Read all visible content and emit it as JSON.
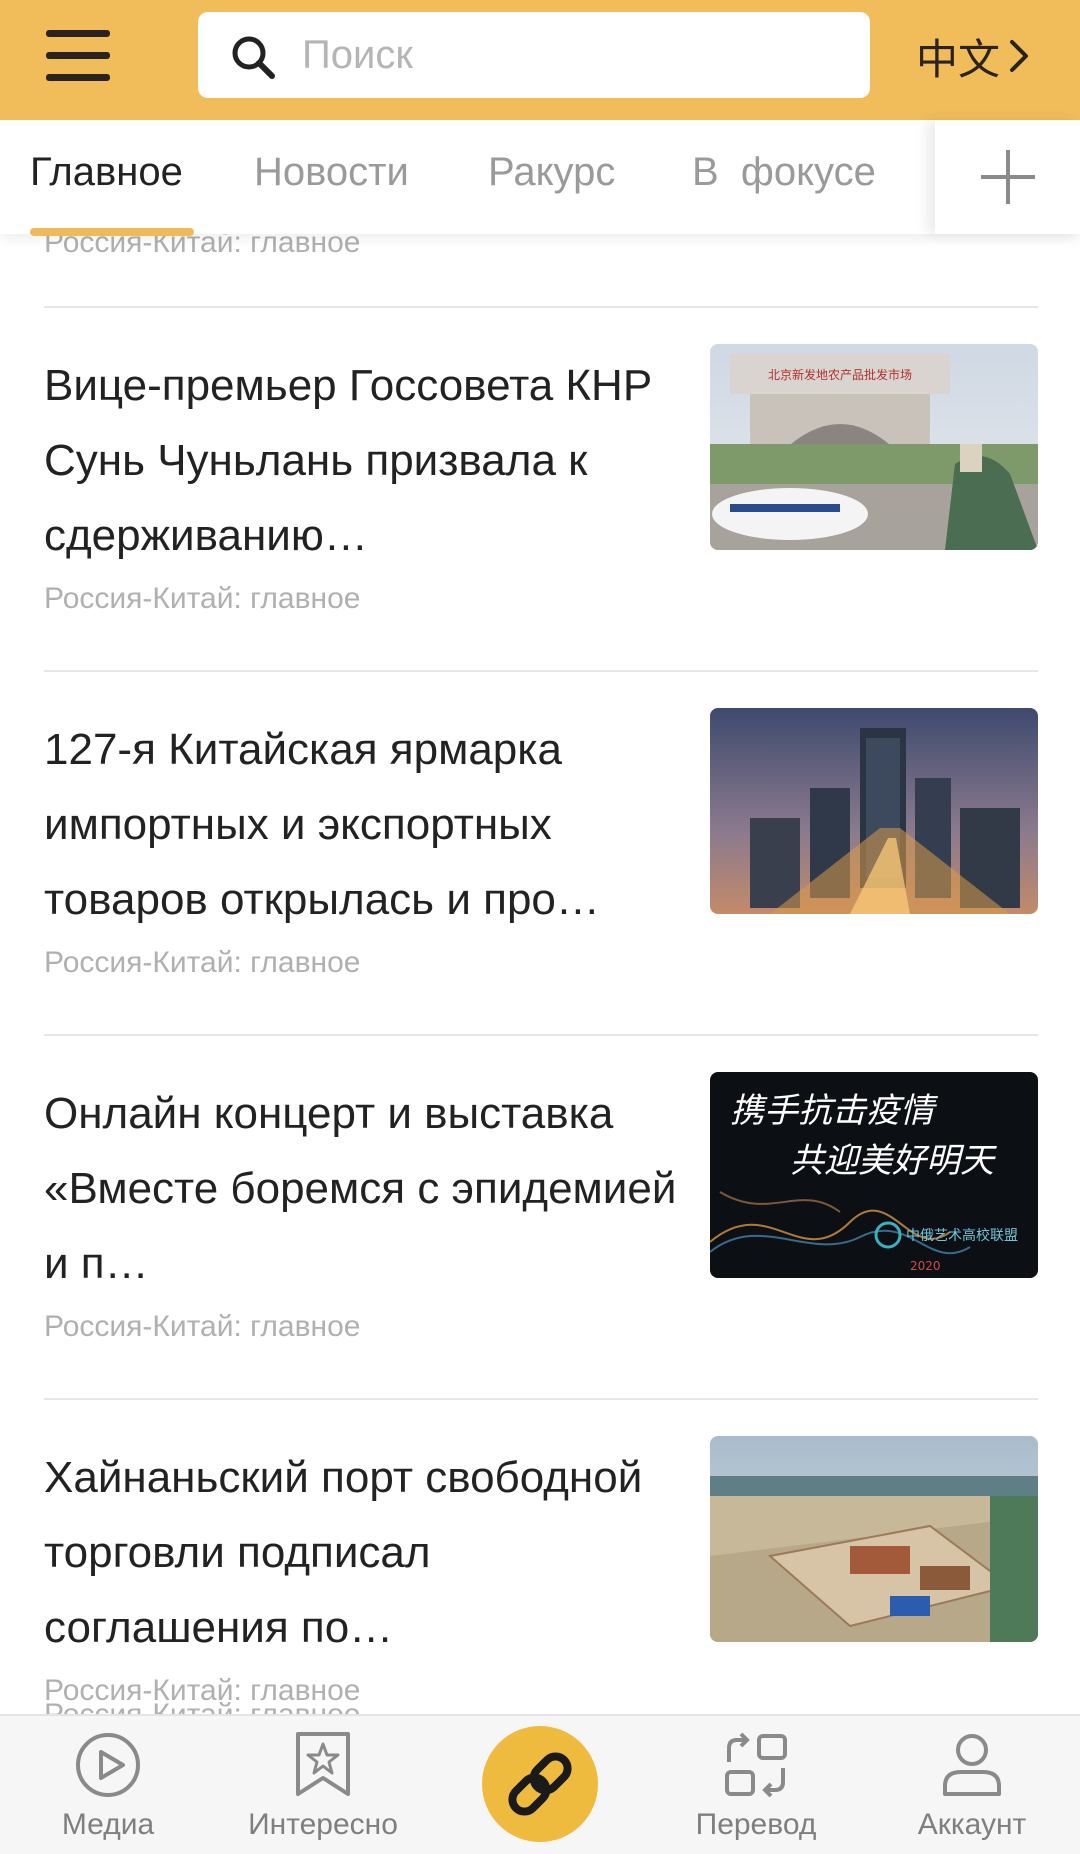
{
  "header": {
    "menu_icon": "hamburger-menu-icon",
    "search": {
      "placeholder": "Поиск",
      "icon": "search-icon"
    },
    "language": {
      "label": "中文",
      "icon": "chevron-right-icon"
    }
  },
  "tabs": [
    {
      "label": "Главное",
      "active": true
    },
    {
      "label": "Новости",
      "active": false
    },
    {
      "label": "Ракурс",
      "active": false
    },
    {
      "label": "В  фокусе",
      "active": false
    }
  ],
  "tabs_add_icon": "plus-icon",
  "feed": {
    "top_partial_meta": "Россия-Китай: главное",
    "articles": [
      {
        "title": "Вице-премьер Госсовета КНР Сунь Чуньлань призвала к сдерживанию…",
        "source": "Россия-Китай: главное"
      },
      {
        "title": "127-я Китайская ярмарка импортных и экспортных товаров открылась и про…",
        "source": "Россия-Китай: главное"
      },
      {
        "title": "Онлайн концерт и выставка «Вместе боремся с эпидемией и п…",
        "source": "Россия-Китай: главное"
      },
      {
        "title": "Хайнаньский порт свободной торговли подписал соглашения по…",
        "source": "Россия-Китай: главное"
      }
    ],
    "bottom_partial_meta": "Россия-Китай: главное"
  },
  "bottom_nav": {
    "items": [
      {
        "label": "Медиа",
        "icon": "play-circle-icon"
      },
      {
        "label": "Интересно",
        "icon": "bookmark-star-icon"
      },
      {
        "label": "Перевод",
        "icon": "translate-icon"
      },
      {
        "label": "Аккаунт",
        "icon": "user-icon"
      }
    ],
    "center_icon": "link-icon"
  },
  "colors": {
    "header_bg": "#f1bd5a",
    "accent": "#efbb5a",
    "center_button": "#efbb3f",
    "text_primary": "#222222",
    "text_muted": "#9a9a9a"
  }
}
